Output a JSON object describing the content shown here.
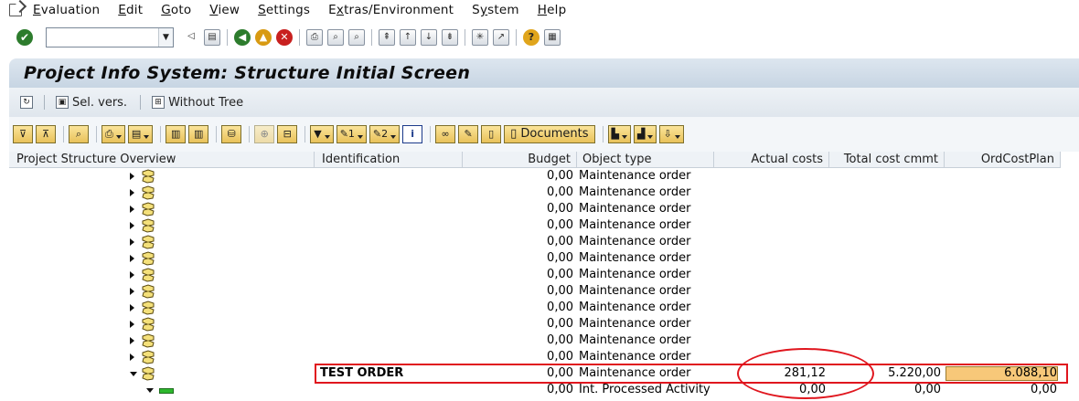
{
  "menu": {
    "items": [
      {
        "pre": "",
        "ul": "E",
        "post": "valuation"
      },
      {
        "pre": "",
        "ul": "E",
        "post": "dit"
      },
      {
        "pre": "",
        "ul": "G",
        "post": "oto"
      },
      {
        "pre": "",
        "ul": "V",
        "post": "iew"
      },
      {
        "pre": "",
        "ul": "S",
        "post": "ettings"
      },
      {
        "pre": "E",
        "ul": "x",
        "post": "tras/Environment"
      },
      {
        "pre": "S",
        "ul": "y",
        "post": "stem"
      },
      {
        "pre": "",
        "ul": "H",
        "post": "elp"
      }
    ]
  },
  "title": "Project Info System: Structure Initial Screen",
  "app_toolbar": {
    "sel_vers": "Sel. vers.",
    "without_tree": "Without Tree"
  },
  "grid_toolbar": {
    "documents": "Documents",
    "btn1": "1",
    "btn2": "2"
  },
  "columns": {
    "overview": "Project Structure Overview",
    "identification": "Identification",
    "budget": "Budget",
    "object_type": "Object type",
    "actual_costs": "Actual costs",
    "total_cost_cmmt": "Total cost cmmt",
    "ord_cost_plan": "OrdCostPlan"
  },
  "rows": [
    {
      "identification": "",
      "budget": "0,00",
      "object_type": "Maintenance order",
      "actual": "",
      "total": "",
      "plan": ""
    },
    {
      "identification": "",
      "budget": "0,00",
      "object_type": "Maintenance order",
      "actual": "",
      "total": "",
      "plan": ""
    },
    {
      "identification": "",
      "budget": "0,00",
      "object_type": "Maintenance order",
      "actual": "",
      "total": "",
      "plan": ""
    },
    {
      "identification": "",
      "budget": "0,00",
      "object_type": "Maintenance order",
      "actual": "",
      "total": "",
      "plan": ""
    },
    {
      "identification": "",
      "budget": "0,00",
      "object_type": "Maintenance order",
      "actual": "",
      "total": "",
      "plan": ""
    },
    {
      "identification": "",
      "budget": "0,00",
      "object_type": "Maintenance order",
      "actual": "",
      "total": "",
      "plan": ""
    },
    {
      "identification": "",
      "budget": "0,00",
      "object_type": "Maintenance order",
      "actual": "",
      "total": "",
      "plan": ""
    },
    {
      "identification": "",
      "budget": "0,00",
      "object_type": "Maintenance order",
      "actual": "",
      "total": "",
      "plan": ""
    },
    {
      "identification": "",
      "budget": "0,00",
      "object_type": "Maintenance order",
      "actual": "",
      "total": "",
      "plan": ""
    },
    {
      "identification": "",
      "budget": "0,00",
      "object_type": "Maintenance order",
      "actual": "",
      "total": "",
      "plan": ""
    },
    {
      "identification": "",
      "budget": "0,00",
      "object_type": "Maintenance order",
      "actual": "",
      "total": "",
      "plan": ""
    },
    {
      "identification": "",
      "budget": "0,00",
      "object_type": "Maintenance order",
      "actual": "",
      "total": "",
      "plan": ""
    },
    {
      "identification": "TEST ORDER",
      "budget": "0,00",
      "object_type": "Maintenance order",
      "actual": "281,12",
      "total": "5.220,00",
      "plan": "6.088,10"
    },
    {
      "identification": "",
      "budget": "0,00",
      "object_type": "Int. Processed Activity",
      "actual": "0,00",
      "total": "0,00",
      "plan": "0,00"
    }
  ],
  "colors": {
    "highlight": "#e0161e",
    "plan_cell": "#f7c879",
    "button_gold": "#e9c25a"
  }
}
